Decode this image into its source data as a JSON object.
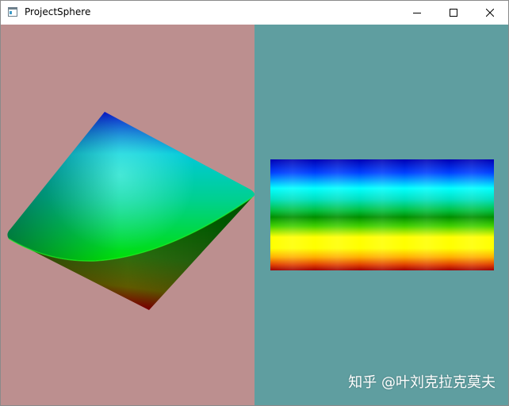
{
  "window": {
    "title": "ProjectSphere",
    "icon": "app-window-icon",
    "controls": {
      "minimize": "minimize-icon",
      "maximize": "maximize-icon",
      "close": "close-icon"
    }
  },
  "viewports": {
    "left": {
      "background": "#bc8f8f",
      "object": "color-gradient-solid"
    },
    "right": {
      "background": "#5f9ea0",
      "object": "color-ramp-texture"
    }
  },
  "colormap": [
    "#0000c0",
    "#00ffff",
    "#00a000",
    "#ffff00",
    "#c00000"
  ],
  "watermark": "知乎 @叶刘克拉克莫夫"
}
